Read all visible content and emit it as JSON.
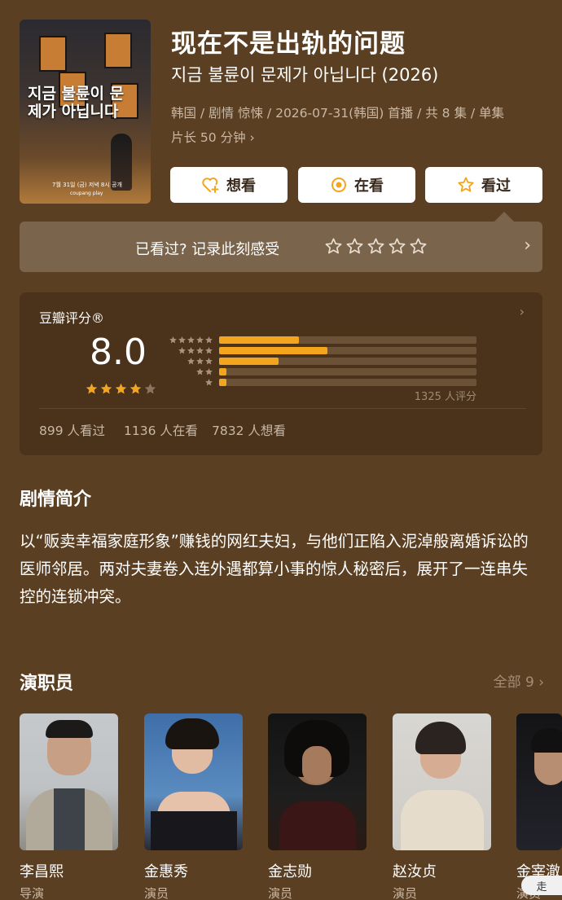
{
  "show": {
    "title_zh": "现在不是出轨的问题",
    "title_ko": "지금 불륜이 문제가 아닙니다 (2026)",
    "meta_line1": "韩国 / 剧情 惊悚 / 2026-07-31(韩国) 首播 / 共 8 集 / 单集",
    "meta_line2": "片长 50 分钟",
    "poster": {
      "title": "지금 불륜이 문제가 아닙니다",
      "date": "7월 31일 (금) 저녁 8시 공개",
      "brand": "coupang play"
    }
  },
  "actions": {
    "want": "想看",
    "watching": "在看",
    "watched": "看过"
  },
  "rate_strip": {
    "text": "已看过? 记录此刻感受",
    "empty_stars": 5
  },
  "rating": {
    "label": "豆瓣评分®",
    "score": "8.0",
    "stars_filled": 4,
    "distribution": [
      {
        "stars": 5,
        "fraction": 0.31
      },
      {
        "stars": 4,
        "fraction": 0.42
      },
      {
        "stars": 3,
        "fraction": 0.23
      },
      {
        "stars": 2,
        "fraction": 0.03
      },
      {
        "stars": 1,
        "fraction": 0.03
      }
    ],
    "count": "1325 人评分",
    "watched": "899 人看过",
    "watching": "1136 人在看",
    "want": "7832 人想看"
  },
  "synopsis": {
    "title": "剧情简介",
    "text": "以“贩卖幸福家庭形象”赚钱的网红夫妇，与他们正陷入泥淖般离婚诉讼的医师邻居。两对夫妻卷入连外遇都算小事的惊人秘密后，展开了一连串失控的连锁冲突。"
  },
  "cast": {
    "title": "演职员",
    "all_link": "全部 9 ›",
    "members": [
      {
        "name": "李昌熙",
        "role": "导演"
      },
      {
        "name": "金惠秀",
        "role": "演员"
      },
      {
        "name": "金志勋",
        "role": "演员"
      },
      {
        "name": "赵汝贞",
        "role": "演员"
      },
      {
        "name": "金宰澈",
        "role": "演员"
      }
    ]
  },
  "bottom_chip": "走",
  "colors": {
    "background": "#5b3f22",
    "card": "#4a321b",
    "accent_star": "#f3a51d",
    "button_bg": "#ffffff"
  }
}
